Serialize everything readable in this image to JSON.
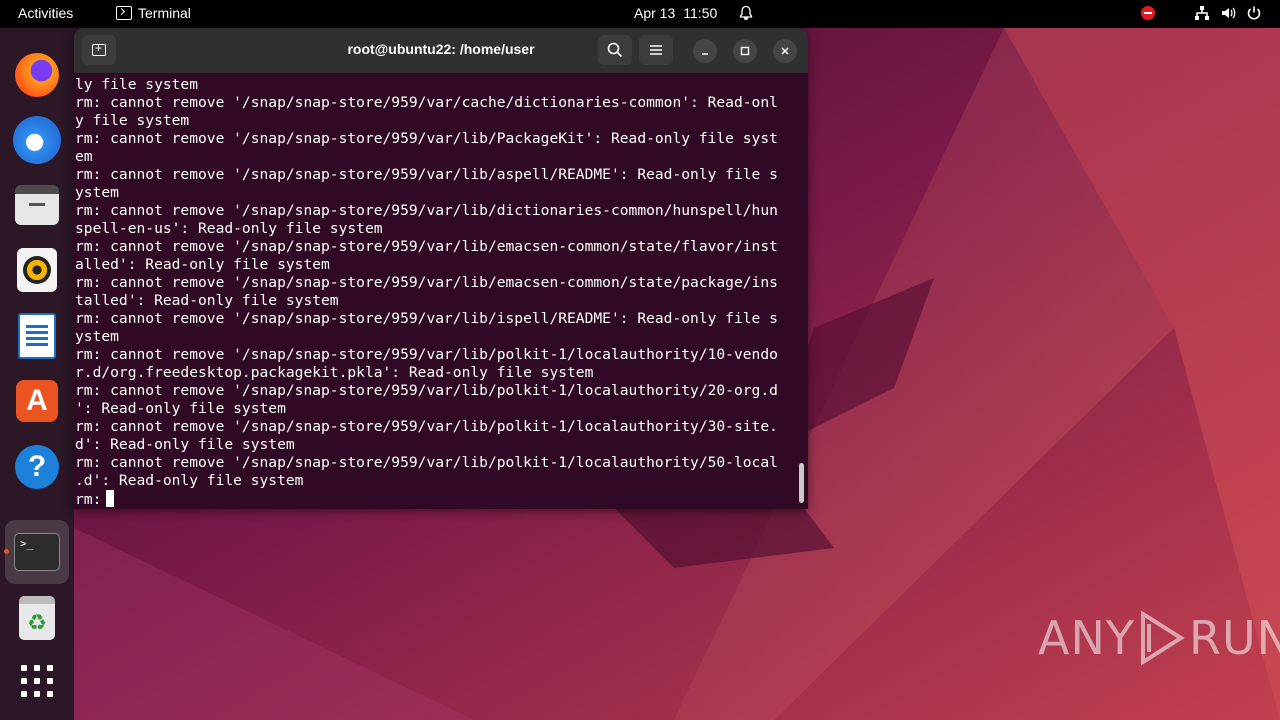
{
  "topbar": {
    "activities": "Activities",
    "app_name": "Terminal",
    "date": "Apr 13",
    "time": "11:50",
    "icons": [
      "terminal-app-icon",
      "bell-icon",
      "do-not-disturb-icon",
      "network-icon",
      "volume-icon",
      "power-icon"
    ]
  },
  "dock": {
    "items": [
      {
        "name": "firefox",
        "icon": "firefox-icon"
      },
      {
        "name": "thunderbird",
        "icon": "thunderbird-icon"
      },
      {
        "name": "files",
        "icon": "files-icon"
      },
      {
        "name": "rhythmbox",
        "icon": "rhythmbox-icon"
      },
      {
        "name": "libreoffice-writer",
        "icon": "writer-icon"
      },
      {
        "name": "ubuntu-software",
        "icon": "app-store-icon",
        "glyph": "A"
      },
      {
        "name": "help",
        "icon": "help-icon",
        "glyph": "?"
      },
      {
        "name": "terminal",
        "icon": "terminal-icon",
        "glyph": ">_",
        "active": true
      },
      {
        "name": "trash",
        "icon": "trash-icon",
        "glyph": "♻"
      },
      {
        "name": "show-applications",
        "icon": "app-grid-icon"
      }
    ]
  },
  "terminal": {
    "title": "root@ubuntu22: /home/user",
    "lines": [
      "ly file system",
      "rm: cannot remove '/snap/snap-store/959/var/cache/dictionaries-common': Read-onl",
      "y file system",
      "rm: cannot remove '/snap/snap-store/959/var/lib/PackageKit': Read-only file syst",
      "em",
      "rm: cannot remove '/snap/snap-store/959/var/lib/aspell/README': Read-only file s",
      "ystem",
      "rm: cannot remove '/snap/snap-store/959/var/lib/dictionaries-common/hunspell/hun",
      "spell-en-us': Read-only file system",
      "rm: cannot remove '/snap/snap-store/959/var/lib/emacsen-common/state/flavor/inst",
      "alled': Read-only file system",
      "rm: cannot remove '/snap/snap-store/959/var/lib/emacsen-common/state/package/ins",
      "talled': Read-only file system",
      "rm: cannot remove '/snap/snap-store/959/var/lib/ispell/README': Read-only file s",
      "ystem",
      "rm: cannot remove '/snap/snap-store/959/var/lib/polkit-1/localauthority/10-vendo",
      "r.d/org.freedesktop.packagekit.pkla': Read-only file system",
      "rm: cannot remove '/snap/snap-store/959/var/lib/polkit-1/localauthority/20-org.d",
      "': Read-only file system",
      "rm: cannot remove '/snap/snap-store/959/var/lib/polkit-1/localauthority/30-site.",
      "d': Read-only file system",
      "rm: cannot remove '/snap/snap-store/959/var/lib/polkit-1/localauthority/50-local",
      ".d': Read-only file system"
    ],
    "prompt": "rm:"
  },
  "watermark": {
    "left": "ANY",
    "right": "RUN"
  },
  "colors": {
    "terminal_bg": "#300a24",
    "titlebar_bg": "#303030",
    "accent": "#e95420"
  }
}
